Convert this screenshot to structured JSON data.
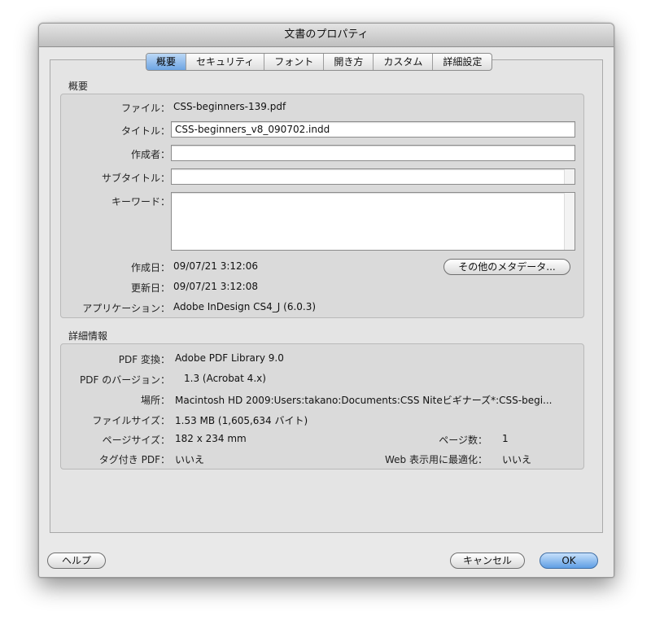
{
  "window": {
    "title": "文書のプロパティ"
  },
  "tabs": [
    {
      "label": "概要",
      "active": true
    },
    {
      "label": "セキュリティ",
      "active": false
    },
    {
      "label": "フォント",
      "active": false
    },
    {
      "label": "開き方",
      "active": false
    },
    {
      "label": "カスタム",
      "active": false
    },
    {
      "label": "詳細設定",
      "active": false
    }
  ],
  "summary": {
    "heading": "概要",
    "file_label": "ファイル：",
    "file_value": "CSS-beginners-139.pdf",
    "title_label": "タイトル：",
    "title_value": "CSS-beginners_v8_090702.indd",
    "author_label": "作成者：",
    "author_value": "",
    "subtitle_label": "サブタイトル：",
    "subtitle_value": "",
    "keywords_label": "キーワード：",
    "keywords_value": "",
    "created_label": "作成日：",
    "created_value": "09/07/21 3:12:06",
    "modified_label": "更新日：",
    "modified_value": "09/07/21 3:12:08",
    "app_label": "アプリケーション：",
    "app_value": "Adobe InDesign CS4_J (6.0.3)",
    "more_metadata_button": "その他のメタデータ..."
  },
  "details": {
    "heading": "詳細情報",
    "pdf_producer_label": "PDF 変換：",
    "pdf_producer_value": "Adobe PDF Library 9.0",
    "pdf_version_label": "PDF のバージョン：",
    "pdf_version_value": "1.3 (Acrobat 4.x)",
    "location_label": "場所：",
    "location_value": "Macintosh HD 2009:Users:takano:Documents:CSS Niteビギナーズ*:CSS-begi...",
    "file_size_label": "ファイルサイズ：",
    "file_size_value": "1.53 MB (1,605,634 バイト)",
    "page_size_label": "ページサイズ：",
    "page_size_value": "182 x 234 mm",
    "page_count_label": "ページ数：",
    "page_count_value": "1",
    "tagged_label": "タグ付き PDF：",
    "tagged_value": "いいえ",
    "fast_web_label": "Web 表示用に最適化：",
    "fast_web_value": "いいえ"
  },
  "footer": {
    "help_button": "ヘルプ",
    "cancel_button": "キャンセル",
    "ok_button": "OK"
  },
  "colors": {
    "accent": "#6ea5e3",
    "window_bg": "#e9e9e9",
    "group_bg": "#dadada"
  }
}
